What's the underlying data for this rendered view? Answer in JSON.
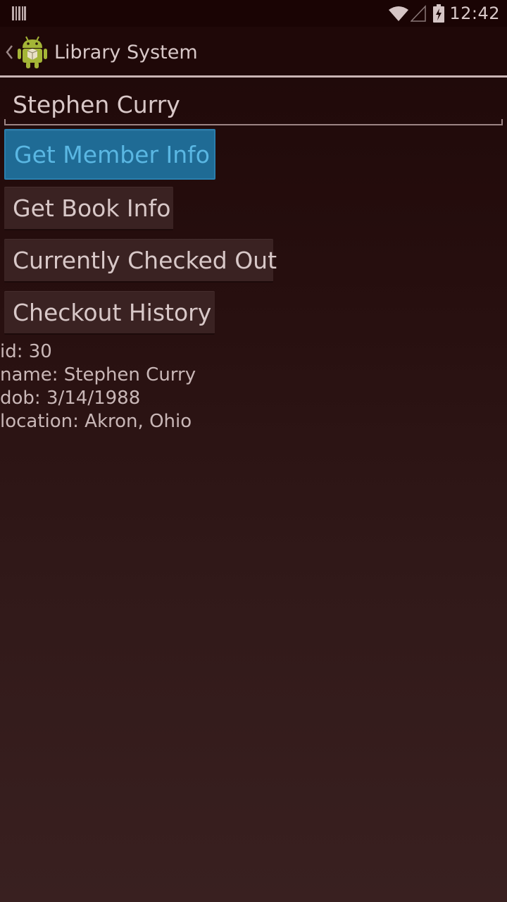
{
  "status_bar": {
    "time": "12:42",
    "icons": [
      "notification-barcode-icon",
      "wifi-icon",
      "no-signal-icon",
      "battery-charging-icon"
    ]
  },
  "action_bar": {
    "title": "Library System",
    "up_icon": "chevron-left-icon",
    "app_icon": "android-robot-icon"
  },
  "search": {
    "value": "Stephen Curry"
  },
  "buttons": {
    "member_info": "Get Member Info",
    "book_info": "Get Book Info",
    "checked_out": "Currently Checked Out",
    "history": "Checkout History"
  },
  "result": {
    "lines": [
      "id: 30",
      "name: Stephen Curry",
      "dob: 3/14/1988",
      "location: Akron, Ohio"
    ]
  },
  "colors": {
    "focused_button": "#1f6b95",
    "focused_button_text": "#5ab7e3",
    "button": "#3a2222",
    "background_top": "#1e0808",
    "background_bottom": "#392020"
  }
}
